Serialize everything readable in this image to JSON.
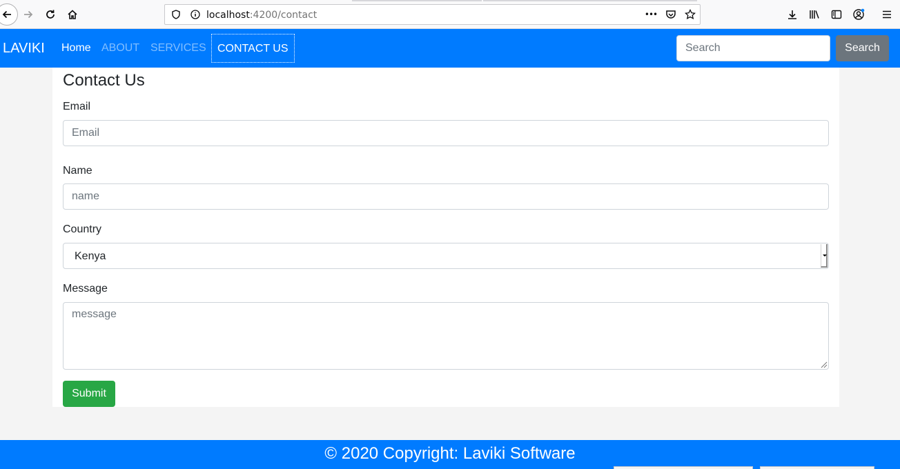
{
  "browser": {
    "url_host": "localhost",
    "url_path": ":4200/contact",
    "more_glyph": "•••"
  },
  "navbar": {
    "brand": "LAVIKI",
    "links": [
      "Home",
      "ABOUT",
      "SERVICES",
      "CONTACT US"
    ],
    "search_placeholder": "Search",
    "search_button": "Search"
  },
  "form": {
    "title": "Contact Us",
    "email_label": "Email",
    "email_placeholder": "Email",
    "name_label": "Name",
    "name_placeholder": "name",
    "country_label": "Country",
    "country_value": "Kenya",
    "message_label": "Message",
    "message_placeholder": "message",
    "submit_label": "Submit"
  },
  "footer": {
    "text": "© 2020 Copyright: Laviki Software"
  },
  "colors": {
    "navbar": "#007bff",
    "submit": "#28a745",
    "search_button": "#6c757d"
  }
}
